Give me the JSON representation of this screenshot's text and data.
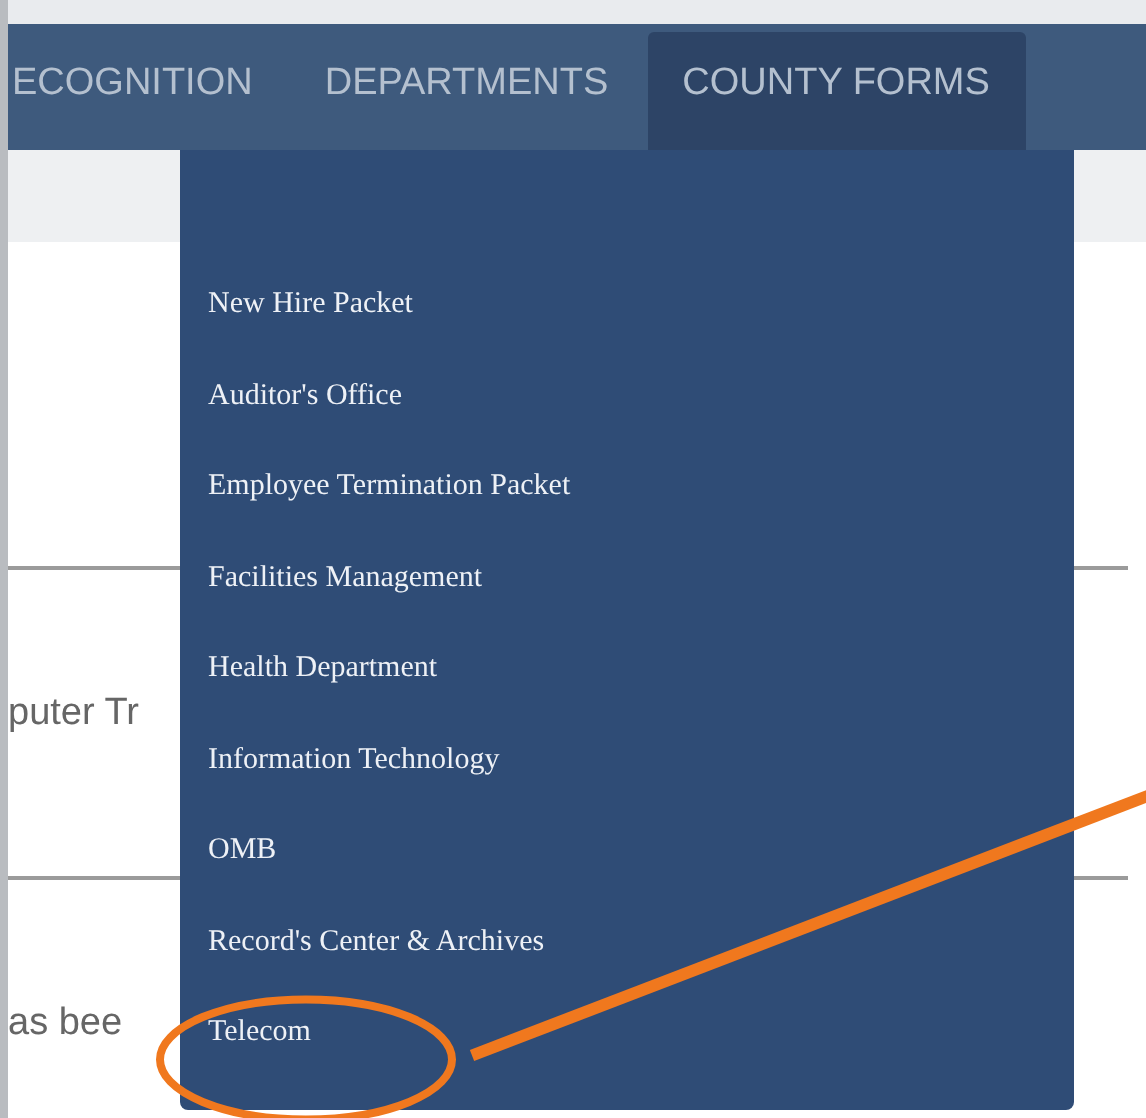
{
  "nav": {
    "tabs": [
      {
        "label": "ECOGNITION",
        "selected": false
      },
      {
        "label": "DEPARTMENTS",
        "selected": false
      },
      {
        "label": "COUNTY FORMS",
        "selected": true
      }
    ]
  },
  "dropdown": {
    "items": [
      {
        "label": "New Hire Packet",
        "circled": false
      },
      {
        "label": "Auditor's Office",
        "circled": false
      },
      {
        "label": "Employee Termination Packet",
        "circled": false
      },
      {
        "label": "Facilities Management",
        "circled": false
      },
      {
        "label": "Health Department",
        "circled": false
      },
      {
        "label": "Information Technology",
        "circled": false
      },
      {
        "label": "OMB",
        "circled": false
      },
      {
        "label": "Record's Center & Archives",
        "circled": false
      },
      {
        "label": "Telecom",
        "circled": true
      }
    ]
  },
  "page_text": [
    "puter Tr",
    "as bee"
  ]
}
